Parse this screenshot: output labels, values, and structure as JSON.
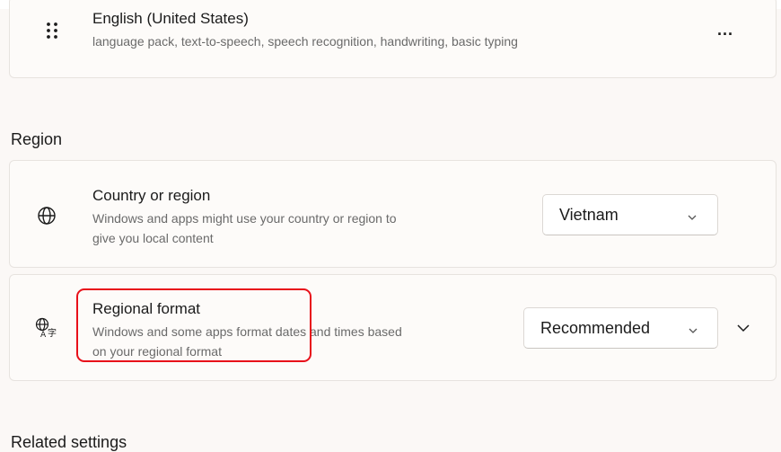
{
  "language_card": {
    "title": "English (United States)",
    "description": "language pack, text-to-speech, speech recognition, handwriting, basic typing",
    "grip_icon": "grip-dots-icon",
    "more_icon": "more-options-icon",
    "more_label": "..."
  },
  "region": {
    "heading": "Region",
    "country": {
      "title": "Country or region",
      "description_line1": "Windows and apps might use your country or region to",
      "description_line2": "give you local content",
      "icon": "globe-icon",
      "value": "Vietnam"
    },
    "format": {
      "title": "Regional format",
      "description_line1": "Windows and some apps format dates and times based",
      "description_line2": "on your regional format",
      "icon": "language-format-icon",
      "value": "Recommended",
      "highlight_color": "#e8101a"
    }
  },
  "related_settings": {
    "heading": "Related settings"
  },
  "colors": {
    "background": "#fbf8f6",
    "card": "#fdfbf9",
    "secondary_text": "#6a6a6a"
  }
}
